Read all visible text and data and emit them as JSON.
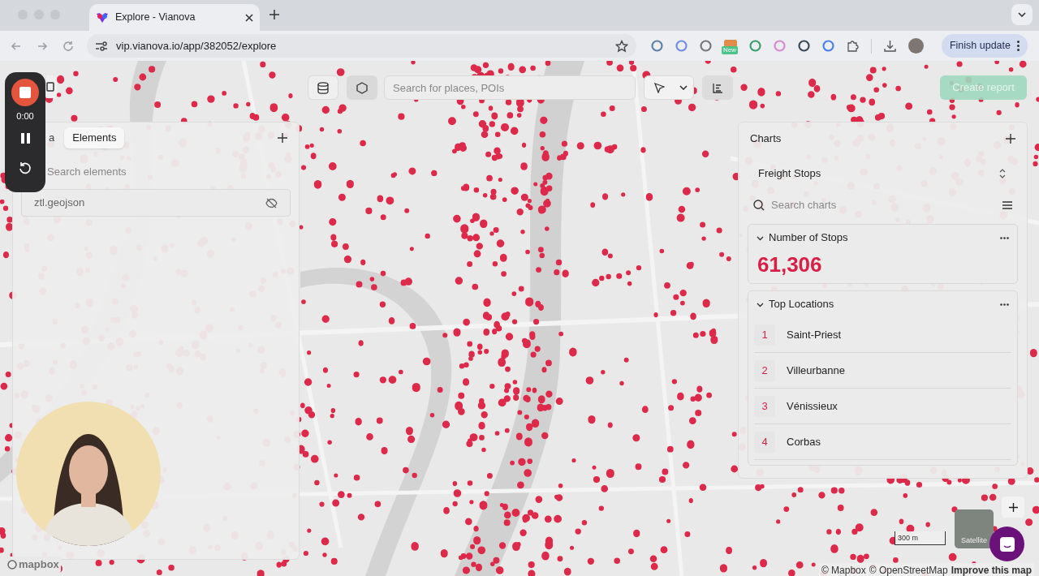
{
  "browser": {
    "tab_title": "Explore - Vianova",
    "url": "vip.vianova.io/app/382052/explore",
    "extension_badge": "New",
    "update_button": "Finish update"
  },
  "recorder": {
    "timer": "0:00"
  },
  "toolbar": {
    "tools": [
      {
        "kind": "database",
        "selected": false
      },
      {
        "kind": "polygon",
        "selected": true
      }
    ],
    "search_placeholder": "Search for places, POIs",
    "create_report": "Create report"
  },
  "left_panel": {
    "tabs": [
      {
        "label": "a",
        "selected": false
      },
      {
        "label": "Elements",
        "selected": true
      }
    ],
    "search_placeholder": "Search elements",
    "layers": [
      {
        "name": "ztl.geojson",
        "visible": false
      }
    ]
  },
  "right_panel": {
    "title": "Charts",
    "dataset": "Freight Stops",
    "search_placeholder": "Search charts",
    "cards": [
      {
        "kind": "number",
        "title": "Number of Stops",
        "expanded": true,
        "value": "61,306"
      },
      {
        "kind": "list",
        "title": "Top Locations",
        "expanded": true,
        "items": [
          {
            "rank": "1",
            "name": "Saint-Priest"
          },
          {
            "rank": "2",
            "name": "Villeurbanne"
          },
          {
            "rank": "3",
            "name": "Vénissieux"
          },
          {
            "rank": "4",
            "name": "Corbas"
          }
        ]
      }
    ]
  },
  "map": {
    "scale": "300 m",
    "layer_button": "Satellite",
    "logo": "mapbox",
    "attribution": [
      "© Mapbox",
      "© OpenStreetMap"
    ],
    "improve_link": "Improve this map"
  }
}
